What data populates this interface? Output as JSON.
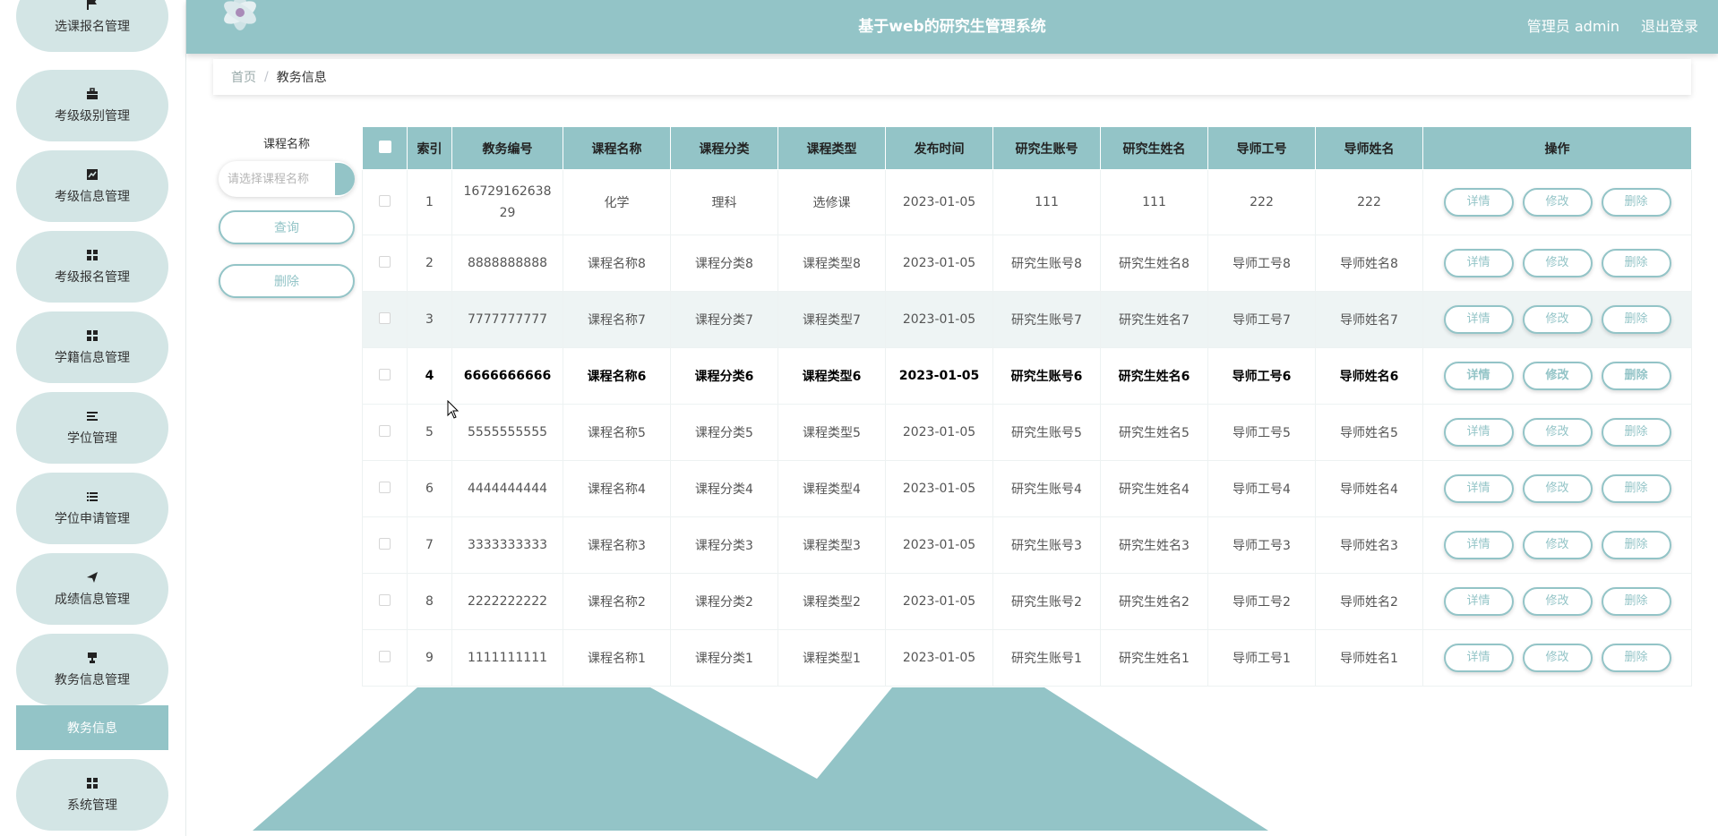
{
  "app": {
    "title": "基于web的研究生管理系统",
    "user": "管理员 admin",
    "logout": "退出登录"
  },
  "colors": {
    "accent": "#93c4c7",
    "nav_bg": "#d3e5e5",
    "row_alt": "#eef4f4"
  },
  "sidebar": {
    "items": [
      {
        "label": "选课报名管理",
        "icon": "flag-icon"
      },
      {
        "label": "考级级别管理",
        "icon": "briefcase-icon"
      },
      {
        "label": "考级信息管理",
        "icon": "chart-icon"
      },
      {
        "label": "考级报名管理",
        "icon": "grid-icon"
      },
      {
        "label": "学籍信息管理",
        "icon": "grid-icon"
      },
      {
        "label": "学位管理",
        "icon": "list-icon"
      },
      {
        "label": "学位申请管理",
        "icon": "list-icon"
      },
      {
        "label": "成绩信息管理",
        "icon": "send-icon"
      },
      {
        "label": "教务信息管理",
        "icon": "stamp-icon"
      },
      {
        "label": "系统管理",
        "icon": "grid-icon"
      }
    ],
    "active_sub": "教务信息"
  },
  "breadcrumb": {
    "home": "首页",
    "separator": "/",
    "current": "教务信息"
  },
  "search": {
    "label": "课程名称",
    "placeholder": "请选择课程名称",
    "query_button": "查询",
    "delete_button": "删除"
  },
  "table": {
    "columns": [
      "索引",
      "教务编号",
      "课程名称",
      "课程分类",
      "课程类型",
      "发布时间",
      "研究生账号",
      "研究生姓名",
      "导师工号",
      "导师姓名",
      "操作"
    ],
    "actions": [
      "详情",
      "修改",
      "删除"
    ],
    "rows": [
      [
        "1",
        "1672916263829",
        "化学",
        "理科",
        "选修课",
        "2023-01-05",
        "111",
        "111",
        "222",
        "222"
      ],
      [
        "2",
        "8888888888",
        "课程名称8",
        "课程分类8",
        "课程类型8",
        "2023-01-05",
        "研究生账号8",
        "研究生姓名8",
        "导师工号8",
        "导师姓名8"
      ],
      [
        "3",
        "7777777777",
        "课程名称7",
        "课程分类7",
        "课程类型7",
        "2023-01-05",
        "研究生账号7",
        "研究生姓名7",
        "导师工号7",
        "导师姓名7"
      ],
      [
        "4",
        "6666666666",
        "课程名称6",
        "课程分类6",
        "课程类型6",
        "2023-01-05",
        "研究生账号6",
        "研究生姓名6",
        "导师工号6",
        "导师姓名6"
      ],
      [
        "5",
        "5555555555",
        "课程名称5",
        "课程分类5",
        "课程类型5",
        "2023-01-05",
        "研究生账号5",
        "研究生姓名5",
        "导师工号5",
        "导师姓名5"
      ],
      [
        "6",
        "4444444444",
        "课程名称4",
        "课程分类4",
        "课程类型4",
        "2023-01-05",
        "研究生账号4",
        "研究生姓名4",
        "导师工号4",
        "导师姓名4"
      ],
      [
        "7",
        "3333333333",
        "课程名称3",
        "课程分类3",
        "课程类型3",
        "2023-01-05",
        "研究生账号3",
        "研究生姓名3",
        "导师工号3",
        "导师姓名3"
      ],
      [
        "8",
        "2222222222",
        "课程名称2",
        "课程分类2",
        "课程类型2",
        "2023-01-05",
        "研究生账号2",
        "研究生姓名2",
        "导师工号2",
        "导师姓名2"
      ],
      [
        "9",
        "1111111111",
        "课程名称1",
        "课程分类1",
        "课程类型1",
        "2023-01-05",
        "研究生账号1",
        "研究生姓名1",
        "导师工号1",
        "导师姓名1"
      ]
    ]
  }
}
